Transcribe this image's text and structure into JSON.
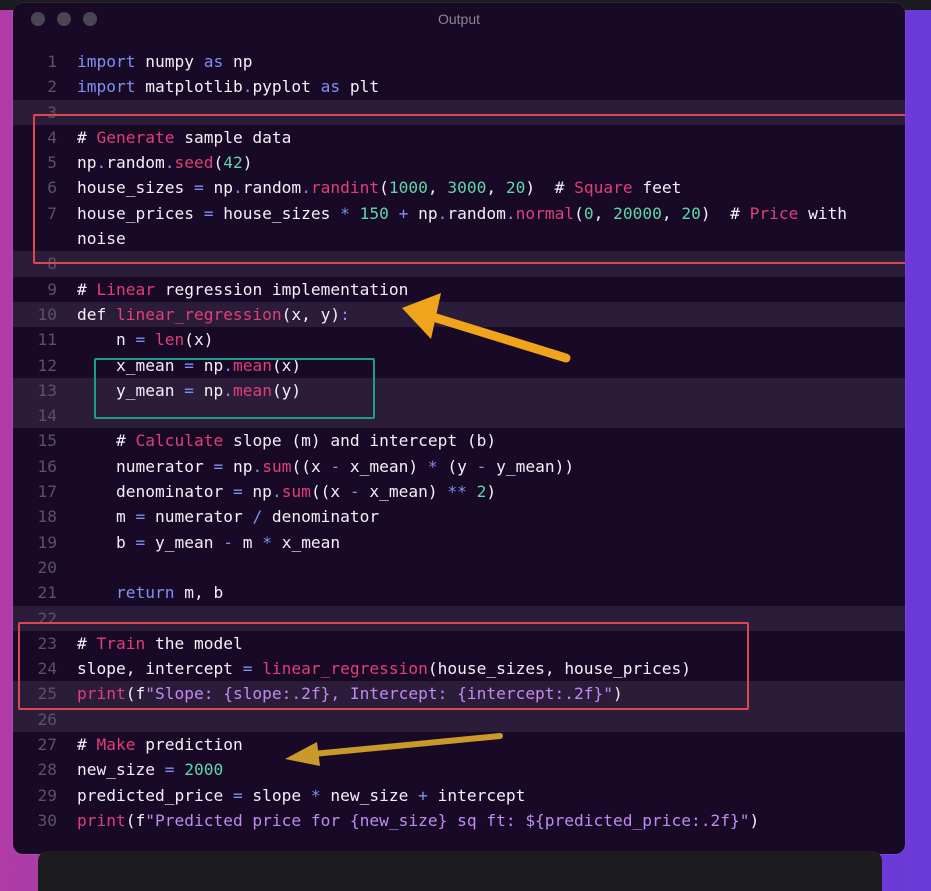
{
  "window": {
    "title": "Output"
  },
  "code": {
    "lines": [
      {
        "n": "1",
        "t": "import numpy as np",
        "tokens": [
          [
            "import",
            "kw"
          ],
          [
            " numpy ",
            ""
          ],
          [
            "as",
            "kw"
          ],
          [
            " np",
            ""
          ]
        ]
      },
      {
        "n": "2",
        "t": "import matplotlib.pyplot as plt",
        "tokens": [
          [
            "import",
            "kw"
          ],
          [
            " matplotlib",
            ""
          ],
          [
            ".",
            "op"
          ],
          [
            "pyplot ",
            ""
          ],
          [
            "as",
            "kw"
          ],
          [
            " plt",
            ""
          ]
        ]
      },
      {
        "n": "3",
        "t": "",
        "tokens": []
      },
      {
        "n": "4",
        "t": "# Generate sample data",
        "tokens": [
          [
            "# ",
            ""
          ],
          [
            "Generate",
            "fn"
          ],
          [
            " sample data",
            ""
          ]
        ]
      },
      {
        "n": "5",
        "t": "np.random.seed(42)",
        "tokens": [
          [
            "np",
            ""
          ],
          [
            ".",
            "op"
          ],
          [
            "random",
            ""
          ],
          [
            ".",
            "op"
          ],
          [
            "seed",
            "fn"
          ],
          [
            "(",
            ""
          ],
          [
            "42",
            "num"
          ],
          [
            ")",
            ""
          ]
        ]
      },
      {
        "n": "6",
        "t": "house_sizes = np.random.randint(1000, 3000, 20)  # Square feet",
        "tokens": [
          [
            "house_sizes ",
            ""
          ],
          [
            "=",
            "op"
          ],
          [
            " np",
            ""
          ],
          [
            ".",
            "op"
          ],
          [
            "random",
            ""
          ],
          [
            ".",
            "op"
          ],
          [
            "randint",
            "fn"
          ],
          [
            "(",
            ""
          ],
          [
            "1000",
            "num"
          ],
          [
            ", ",
            ""
          ],
          [
            "3000",
            "num"
          ],
          [
            ", ",
            ""
          ],
          [
            "20",
            "num"
          ],
          [
            ")  # ",
            ""
          ],
          [
            "Square",
            "fn"
          ],
          [
            " feet",
            ""
          ]
        ]
      },
      {
        "n": "7",
        "t": "house_prices = house_sizes * 150 + np.random.normal(0, 20000, 20)  # Price with noise",
        "tokens": [
          [
            "house_prices ",
            ""
          ],
          [
            "=",
            "op"
          ],
          [
            " house_sizes ",
            ""
          ],
          [
            "*",
            "op"
          ],
          [
            " ",
            ""
          ],
          [
            "150",
            "num"
          ],
          [
            " ",
            ""
          ],
          [
            "+",
            "op"
          ],
          [
            " np",
            ""
          ],
          [
            ".",
            "op"
          ],
          [
            "random",
            ""
          ],
          [
            ".",
            "op"
          ],
          [
            "normal",
            "fn"
          ],
          [
            "(",
            ""
          ],
          [
            "0",
            "num"
          ],
          [
            ", ",
            ""
          ],
          [
            "20000",
            "num"
          ],
          [
            ", ",
            ""
          ],
          [
            "20",
            "num"
          ],
          [
            ")  # ",
            ""
          ],
          [
            "Price",
            "fn"
          ],
          [
            " with noise",
            ""
          ]
        ]
      },
      {
        "n": "8",
        "t": "",
        "tokens": []
      },
      {
        "n": "9",
        "t": "# Linear regression implementation",
        "tokens": [
          [
            "# ",
            ""
          ],
          [
            "Linear",
            "fn"
          ],
          [
            " regression implementation",
            ""
          ]
        ]
      },
      {
        "n": "10",
        "t": "def linear_regression(x, y):",
        "tokens": [
          [
            "def ",
            ""
          ],
          [
            "linear_regression",
            "fn"
          ],
          [
            "(x, y)",
            ""
          ],
          [
            ":",
            "op"
          ]
        ]
      },
      {
        "n": "11",
        "t": "    n = len(x)",
        "tokens": [
          [
            "    n ",
            ""
          ],
          [
            "=",
            "op"
          ],
          [
            " ",
            ""
          ],
          [
            "len",
            "fn"
          ],
          [
            "(x)",
            ""
          ]
        ]
      },
      {
        "n": "12",
        "t": "    x_mean = np.mean(x)",
        "tokens": [
          [
            "    x_mean ",
            ""
          ],
          [
            "=",
            "op"
          ],
          [
            " np",
            ""
          ],
          [
            ".",
            "op"
          ],
          [
            "mean",
            "fn"
          ],
          [
            "(x)",
            ""
          ]
        ]
      },
      {
        "n": "13",
        "t": "    y_mean = np.mean(y)",
        "tokens": [
          [
            "    y_mean ",
            ""
          ],
          [
            "=",
            "op"
          ],
          [
            " np",
            ""
          ],
          [
            ".",
            "op"
          ],
          [
            "mean",
            "fn"
          ],
          [
            "(y)",
            ""
          ]
        ]
      },
      {
        "n": "14",
        "t": "",
        "tokens": []
      },
      {
        "n": "15",
        "t": "    # Calculate slope (m) and intercept (b)",
        "tokens": [
          [
            "    # ",
            ""
          ],
          [
            "Calculate",
            "fn"
          ],
          [
            " slope (m) and intercept (b)",
            ""
          ]
        ]
      },
      {
        "n": "16",
        "t": "    numerator = np.sum((x - x_mean) * (y - y_mean))",
        "tokens": [
          [
            "    numerator ",
            ""
          ],
          [
            "=",
            "op"
          ],
          [
            " np",
            ""
          ],
          [
            ".",
            "op"
          ],
          [
            "sum",
            "fn"
          ],
          [
            "((x ",
            ""
          ],
          [
            "-",
            "op"
          ],
          [
            " x_mean) ",
            ""
          ],
          [
            "*",
            "op"
          ],
          [
            " (y ",
            ""
          ],
          [
            "-",
            "op"
          ],
          [
            " y_mean))",
            ""
          ]
        ]
      },
      {
        "n": "17",
        "t": "    denominator = np.sum((x - x_mean) ** 2)",
        "tokens": [
          [
            "    denominator ",
            ""
          ],
          [
            "=",
            "op"
          ],
          [
            " np",
            ""
          ],
          [
            ".",
            "op"
          ],
          [
            "sum",
            "fn"
          ],
          [
            "((x ",
            ""
          ],
          [
            "-",
            "op"
          ],
          [
            " x_mean) ",
            ""
          ],
          [
            "**",
            "op"
          ],
          [
            " ",
            ""
          ],
          [
            "2",
            "num"
          ],
          [
            ")",
            ""
          ]
        ]
      },
      {
        "n": "18",
        "t": "    m = numerator / denominator",
        "tokens": [
          [
            "    m ",
            ""
          ],
          [
            "=",
            "op"
          ],
          [
            " numerator ",
            ""
          ],
          [
            "/",
            "op"
          ],
          [
            " denominator",
            ""
          ]
        ]
      },
      {
        "n": "19",
        "t": "    b = y_mean - m * x_mean",
        "tokens": [
          [
            "    b ",
            ""
          ],
          [
            "=",
            "op"
          ],
          [
            " y_mean ",
            ""
          ],
          [
            "-",
            "op"
          ],
          [
            " m ",
            ""
          ],
          [
            "*",
            "op"
          ],
          [
            " x_mean",
            ""
          ]
        ]
      },
      {
        "n": "20",
        "t": "",
        "tokens": []
      },
      {
        "n": "21",
        "t": "    return m, b",
        "tokens": [
          [
            "    ",
            ""
          ],
          [
            "return",
            "kw"
          ],
          [
            " m, b",
            ""
          ]
        ]
      },
      {
        "n": "22",
        "t": "",
        "tokens": []
      },
      {
        "n": "23",
        "t": "# Train the model",
        "tokens": [
          [
            "# ",
            ""
          ],
          [
            "Train",
            "fn"
          ],
          [
            " the model",
            ""
          ]
        ]
      },
      {
        "n": "24",
        "t": "slope, intercept = linear_regression(house_sizes, house_prices)",
        "tokens": [
          [
            "slope, intercept ",
            ""
          ],
          [
            "=",
            "op"
          ],
          [
            " ",
            ""
          ],
          [
            "linear_regression",
            "fn"
          ],
          [
            "(house_sizes, house_prices)",
            ""
          ]
        ]
      },
      {
        "n": "25",
        "t": "print(f\"Slope: {slope:.2f}, Intercept: {intercept:.2f}\")",
        "tokens": [
          [
            "print",
            "fn"
          ],
          [
            "(f",
            ""
          ],
          [
            "\"Slope: {slope:.2f}, Intercept: {intercept:.2f}\"",
            "str"
          ],
          [
            ")",
            ""
          ]
        ]
      },
      {
        "n": "26",
        "t": "",
        "tokens": []
      },
      {
        "n": "27",
        "t": "# Make prediction",
        "tokens": [
          [
            "# ",
            ""
          ],
          [
            "Make",
            "fn"
          ],
          [
            " prediction",
            ""
          ]
        ]
      },
      {
        "n": "28",
        "t": "new_size = 2000",
        "tokens": [
          [
            "new_size ",
            ""
          ],
          [
            "=",
            "op"
          ],
          [
            " ",
            ""
          ],
          [
            "2000",
            "num"
          ]
        ]
      },
      {
        "n": "29",
        "t": "predicted_price = slope * new_size + intercept",
        "tokens": [
          [
            "predicted_price ",
            ""
          ],
          [
            "=",
            "op"
          ],
          [
            " slope ",
            ""
          ],
          [
            "*",
            "op"
          ],
          [
            " new_size ",
            ""
          ],
          [
            "+",
            "op"
          ],
          [
            " intercept",
            ""
          ]
        ]
      },
      {
        "n": "30",
        "t": "print(f\"Predicted price for {new_size} sq ft: ${predicted_price:.2f}\")",
        "tokens": [
          [
            "print",
            "fn"
          ],
          [
            "(f",
            ""
          ],
          [
            "\"Predicted price for {new_size} sq ft: ${predicted_price:.2f}\"",
            "str"
          ],
          [
            ")",
            ""
          ]
        ]
      }
    ],
    "highlighted_lines": [
      "3",
      "8",
      "10",
      "13",
      "14",
      "22",
      "25",
      "26"
    ]
  },
  "colors": {
    "accent_red": "#e0464f",
    "accent_teal": "#1c9d88",
    "arrow_orange": "#f0a41c",
    "arrow_gold": "#c9992c"
  }
}
